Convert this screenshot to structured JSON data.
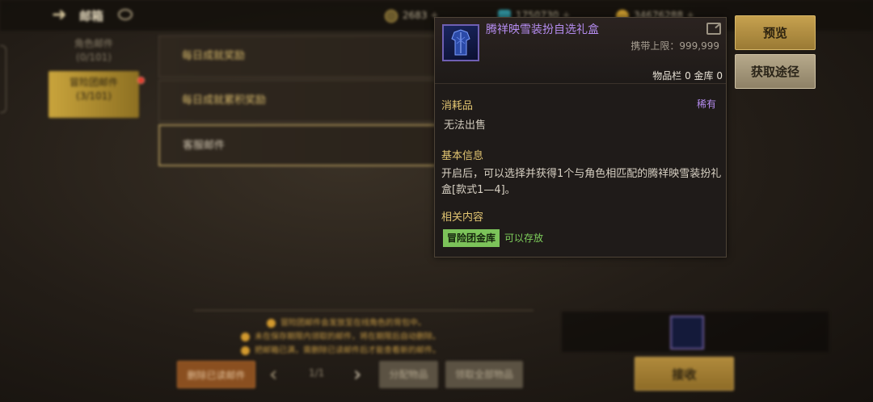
{
  "topbar": {
    "title": "邮箱",
    "currencies": [
      {
        "icon": "gold-coin-icon",
        "value": "2683"
      },
      {
        "icon": "crystal-icon",
        "value": "1750730"
      },
      {
        "icon": "gold-pile-icon",
        "value": "34676288"
      }
    ]
  },
  "sidebar": {
    "items": [
      {
        "label": "角色邮件",
        "count": "(0/101)"
      },
      {
        "label": "冒险团邮件",
        "count": "(3/101)"
      }
    ]
  },
  "mail_list": [
    "每日成就奖励",
    "每日成就累积奖励",
    "客服邮件"
  ],
  "notes": [
    "冒险团邮件会发放至在线角色的背包中。",
    "未在保存期限内领取的邮件，将在期限后自动删除。",
    "把邮箱已满，需删除已读邮件后才能查看新的邮件。"
  ],
  "bottom": {
    "delete_read": "删除已读邮件",
    "page": "1/1",
    "distribute": "分配物品",
    "claim_all": "领取全部物品",
    "receive": "接收"
  },
  "tooltip": {
    "name": "腾祥映雪装扮自选礼盒",
    "carry_limit": "携带上限：999,999",
    "storage": "物品栏 0 金库 0",
    "category": "消耗品",
    "rarity": "稀有",
    "sell": "无法出售",
    "basic_title": "基本信息",
    "basic_text": "开启后，可以选择并获得1个与角色相匹配的腾祥映雪装扮礼盒[款式1—4]。",
    "related_title": "相关内容",
    "related_tag": "冒险团金库",
    "related_status": "可以存放",
    "colors": {
      "rare": "#b58cf0",
      "section": "#e1c471",
      "ok": "#7fd05c"
    }
  },
  "side_buttons": {
    "preview": "预览",
    "source": "获取途径"
  }
}
